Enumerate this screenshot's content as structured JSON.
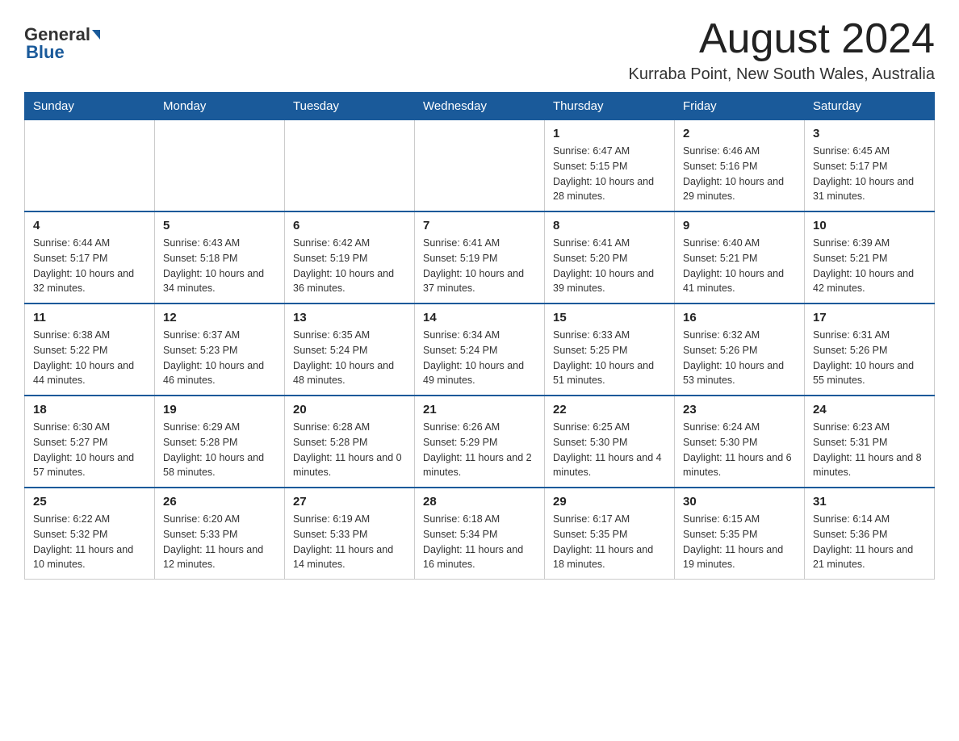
{
  "header": {
    "logo_general": "General",
    "logo_blue": "Blue",
    "month_title": "August 2024",
    "location": "Kurraba Point, New South Wales, Australia"
  },
  "days_of_week": [
    "Sunday",
    "Monday",
    "Tuesday",
    "Wednesday",
    "Thursday",
    "Friday",
    "Saturday"
  ],
  "weeks": [
    [
      {
        "day": "",
        "info": ""
      },
      {
        "day": "",
        "info": ""
      },
      {
        "day": "",
        "info": ""
      },
      {
        "day": "",
        "info": ""
      },
      {
        "day": "1",
        "info": "Sunrise: 6:47 AM\nSunset: 5:15 PM\nDaylight: 10 hours and 28 minutes."
      },
      {
        "day": "2",
        "info": "Sunrise: 6:46 AM\nSunset: 5:16 PM\nDaylight: 10 hours and 29 minutes."
      },
      {
        "day": "3",
        "info": "Sunrise: 6:45 AM\nSunset: 5:17 PM\nDaylight: 10 hours and 31 minutes."
      }
    ],
    [
      {
        "day": "4",
        "info": "Sunrise: 6:44 AM\nSunset: 5:17 PM\nDaylight: 10 hours and 32 minutes."
      },
      {
        "day": "5",
        "info": "Sunrise: 6:43 AM\nSunset: 5:18 PM\nDaylight: 10 hours and 34 minutes."
      },
      {
        "day": "6",
        "info": "Sunrise: 6:42 AM\nSunset: 5:19 PM\nDaylight: 10 hours and 36 minutes."
      },
      {
        "day": "7",
        "info": "Sunrise: 6:41 AM\nSunset: 5:19 PM\nDaylight: 10 hours and 37 minutes."
      },
      {
        "day": "8",
        "info": "Sunrise: 6:41 AM\nSunset: 5:20 PM\nDaylight: 10 hours and 39 minutes."
      },
      {
        "day": "9",
        "info": "Sunrise: 6:40 AM\nSunset: 5:21 PM\nDaylight: 10 hours and 41 minutes."
      },
      {
        "day": "10",
        "info": "Sunrise: 6:39 AM\nSunset: 5:21 PM\nDaylight: 10 hours and 42 minutes."
      }
    ],
    [
      {
        "day": "11",
        "info": "Sunrise: 6:38 AM\nSunset: 5:22 PM\nDaylight: 10 hours and 44 minutes."
      },
      {
        "day": "12",
        "info": "Sunrise: 6:37 AM\nSunset: 5:23 PM\nDaylight: 10 hours and 46 minutes."
      },
      {
        "day": "13",
        "info": "Sunrise: 6:35 AM\nSunset: 5:24 PM\nDaylight: 10 hours and 48 minutes."
      },
      {
        "day": "14",
        "info": "Sunrise: 6:34 AM\nSunset: 5:24 PM\nDaylight: 10 hours and 49 minutes."
      },
      {
        "day": "15",
        "info": "Sunrise: 6:33 AM\nSunset: 5:25 PM\nDaylight: 10 hours and 51 minutes."
      },
      {
        "day": "16",
        "info": "Sunrise: 6:32 AM\nSunset: 5:26 PM\nDaylight: 10 hours and 53 minutes."
      },
      {
        "day": "17",
        "info": "Sunrise: 6:31 AM\nSunset: 5:26 PM\nDaylight: 10 hours and 55 minutes."
      }
    ],
    [
      {
        "day": "18",
        "info": "Sunrise: 6:30 AM\nSunset: 5:27 PM\nDaylight: 10 hours and 57 minutes."
      },
      {
        "day": "19",
        "info": "Sunrise: 6:29 AM\nSunset: 5:28 PM\nDaylight: 10 hours and 58 minutes."
      },
      {
        "day": "20",
        "info": "Sunrise: 6:28 AM\nSunset: 5:28 PM\nDaylight: 11 hours and 0 minutes."
      },
      {
        "day": "21",
        "info": "Sunrise: 6:26 AM\nSunset: 5:29 PM\nDaylight: 11 hours and 2 minutes."
      },
      {
        "day": "22",
        "info": "Sunrise: 6:25 AM\nSunset: 5:30 PM\nDaylight: 11 hours and 4 minutes."
      },
      {
        "day": "23",
        "info": "Sunrise: 6:24 AM\nSunset: 5:30 PM\nDaylight: 11 hours and 6 minutes."
      },
      {
        "day": "24",
        "info": "Sunrise: 6:23 AM\nSunset: 5:31 PM\nDaylight: 11 hours and 8 minutes."
      }
    ],
    [
      {
        "day": "25",
        "info": "Sunrise: 6:22 AM\nSunset: 5:32 PM\nDaylight: 11 hours and 10 minutes."
      },
      {
        "day": "26",
        "info": "Sunrise: 6:20 AM\nSunset: 5:33 PM\nDaylight: 11 hours and 12 minutes."
      },
      {
        "day": "27",
        "info": "Sunrise: 6:19 AM\nSunset: 5:33 PM\nDaylight: 11 hours and 14 minutes."
      },
      {
        "day": "28",
        "info": "Sunrise: 6:18 AM\nSunset: 5:34 PM\nDaylight: 11 hours and 16 minutes."
      },
      {
        "day": "29",
        "info": "Sunrise: 6:17 AM\nSunset: 5:35 PM\nDaylight: 11 hours and 18 minutes."
      },
      {
        "day": "30",
        "info": "Sunrise: 6:15 AM\nSunset: 5:35 PM\nDaylight: 11 hours and 19 minutes."
      },
      {
        "day": "31",
        "info": "Sunrise: 6:14 AM\nSunset: 5:36 PM\nDaylight: 11 hours and 21 minutes."
      }
    ]
  ]
}
